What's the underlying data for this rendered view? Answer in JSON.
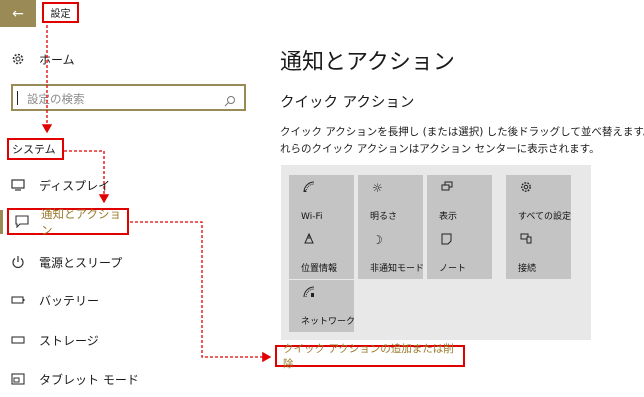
{
  "header": {
    "back_icon": "back-arrow-icon",
    "title": "設定"
  },
  "sidebar": {
    "home": {
      "icon": "gear-icon",
      "label": "ホーム"
    },
    "search": {
      "placeholder": "設定の検索",
      "icon": "search-icon"
    },
    "category": "システム",
    "items": [
      {
        "icon": "display-icon",
        "label": "ディスプレイ"
      },
      {
        "icon": "notification-icon",
        "label": "通知とアクション",
        "selected": true
      },
      {
        "icon": "power-icon",
        "label": "電源とスリープ"
      },
      {
        "icon": "battery-icon",
        "label": "バッテリー"
      },
      {
        "icon": "storage-icon",
        "label": "ストレージ"
      },
      {
        "icon": "tablet-mode-icon",
        "label": "タブレット モード"
      }
    ]
  },
  "main": {
    "title": "通知とアクション",
    "section_title": "クイック アクション",
    "description_line1": "クイック アクションを長押し (または選択) した後ドラッグして並べ替えます。こ",
    "description_line2": "れらのクイック アクションはアクション センターに表示されます。",
    "tiles": [
      {
        "icon": "wifi-icon",
        "label": "Wi-Fi"
      },
      {
        "icon": "brightness-icon",
        "label": "明るさ"
      },
      {
        "icon": "project-icon",
        "label": "表示"
      },
      {
        "icon": "settings-icon",
        "label": "すべての設定"
      },
      {
        "icon": "location-icon",
        "label": "位置情報"
      },
      {
        "icon": "quiet-hours-icon",
        "label": "非通知モード"
      },
      {
        "icon": "note-icon",
        "label": "ノート"
      },
      {
        "icon": "connect-icon",
        "label": "接続"
      },
      {
        "icon": "network-icon",
        "label": "ネットワーク"
      }
    ],
    "link": "クイック アクションの追加または削除"
  },
  "colors": {
    "accent": "#9a8a55",
    "highlight_red": "#e00000",
    "tile": "#c4c4c4",
    "link": "#9a7a2a"
  }
}
